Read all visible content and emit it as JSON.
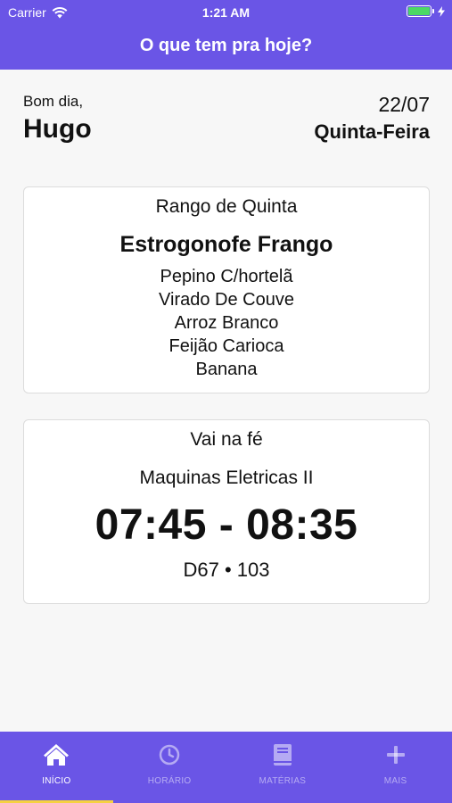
{
  "status": {
    "carrier": "Carrier",
    "time": "1:21 AM"
  },
  "nav": {
    "title": "O que tem pra hoje?"
  },
  "greeting": {
    "hello": "Bom dia,",
    "name": "Hugo"
  },
  "date": {
    "day": "22/07",
    "weekday": "Quinta-Feira"
  },
  "menu": {
    "title": "Rango de Quinta",
    "main": "Estrogonofe Frango",
    "items": [
      "Pepino C/hortelã",
      "Virado De Couve",
      "Arroz Branco",
      "Feijão Carioca",
      "Banana"
    ]
  },
  "class": {
    "title": "Vai na fé",
    "subject": "Maquinas Eletricas II",
    "time": "07:45 - 08:35",
    "room": "D67 • 103"
  },
  "tabs": [
    {
      "label": "INÍCIO",
      "icon": "home-icon",
      "active": true
    },
    {
      "label": "HORÁRIO",
      "icon": "clock-icon",
      "active": false
    },
    {
      "label": "MATÉRIAS",
      "icon": "book-icon",
      "active": false
    },
    {
      "label": "MAIS",
      "icon": "plus-icon",
      "active": false
    }
  ],
  "colors": {
    "brand": "#6a55e6",
    "tab_indicator": "#f5d142",
    "battery": "#4cd964"
  }
}
